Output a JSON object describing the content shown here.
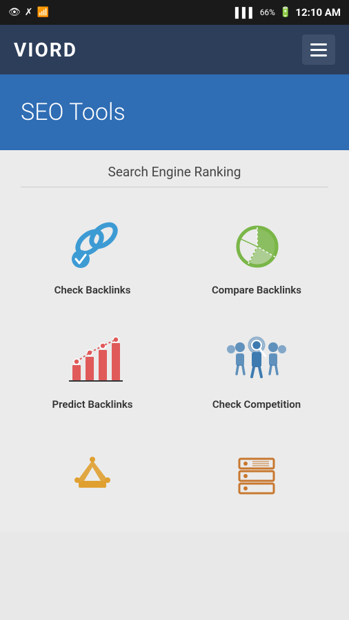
{
  "statusBar": {
    "time": "12:10 AM",
    "battery": "66%",
    "icons": [
      "eye",
      "bluetooth",
      "wifi",
      "signal",
      "battery"
    ]
  },
  "appBar": {
    "logo": "VIORD",
    "menuAriaLabel": "Menu"
  },
  "hero": {
    "title": "SEO Tools"
  },
  "main": {
    "sectionTitle": "Search Engine Ranking",
    "tools": [
      {
        "id": "check-backlinks",
        "label": "Check Backlinks",
        "iconColor": "#3d9bd4"
      },
      {
        "id": "compare-backlinks",
        "label": "Compare Backlinks",
        "iconColor": "#7ab648"
      },
      {
        "id": "predict-backlinks",
        "label": "Predict Backlinks",
        "iconColor": "#e05a5a"
      },
      {
        "id": "check-competition",
        "label": "Check Competition",
        "iconColor": "#3d7ab0"
      }
    ],
    "bottomTools": [
      {
        "id": "tool-5",
        "label": "",
        "iconColor": "#e0a030"
      },
      {
        "id": "tool-6",
        "label": "",
        "iconColor": "#c87830"
      }
    ]
  }
}
